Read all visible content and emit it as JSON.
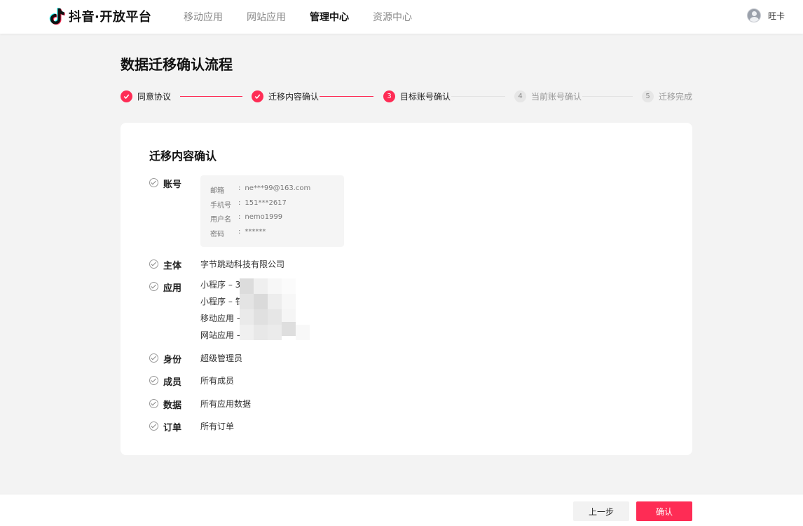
{
  "header": {
    "logo_text": "抖音·开放平台",
    "nav": [
      {
        "label": "移动应用",
        "active": false
      },
      {
        "label": "网站应用",
        "active": false
      },
      {
        "label": "管理中心",
        "active": true
      },
      {
        "label": "资源中心",
        "active": false
      }
    ],
    "user_name": "旺卡"
  },
  "page_title": "数据迁移确认流程",
  "steps": [
    {
      "index": "1",
      "label": "同意协议",
      "state": "done"
    },
    {
      "index": "2",
      "label": "迁移内容确认",
      "state": "done"
    },
    {
      "index": "3",
      "label": "目标账号确认",
      "state": "current"
    },
    {
      "index": "4",
      "label": "当前账号确认",
      "state": "todo"
    },
    {
      "index": "5",
      "label": "迁移完成",
      "state": "todo"
    }
  ],
  "card": {
    "title": "迁移内容确认",
    "account": {
      "label": "账号",
      "fields": [
        {
          "key": "邮箱",
          "value": "ne***99@163.com"
        },
        {
          "key": "手机号",
          "value": "151***2617"
        },
        {
          "key": "用户名",
          "value": "nemo1999"
        },
        {
          "key": "密码",
          "value": "******"
        }
      ]
    },
    "subject": {
      "label": "主体",
      "value": "字节跳动科技有限公司"
    },
    "apps": {
      "label": "应用",
      "items": [
        "小程序 – 3",
        "小程序 – 钅",
        "移动应用 –",
        "网站应用 –"
      ]
    },
    "identity": {
      "label": "身份",
      "value": "超级管理员"
    },
    "members": {
      "label": "成员",
      "value": "所有成员"
    },
    "data": {
      "label": "数据",
      "value": "所有应用数据"
    },
    "orders": {
      "label": "订单",
      "value": "所有订单"
    }
  },
  "footer": {
    "prev_label": "上一步",
    "confirm_label": "确认"
  },
  "colors": {
    "accent": "#fe2c55",
    "background": "#f3f3f3"
  }
}
